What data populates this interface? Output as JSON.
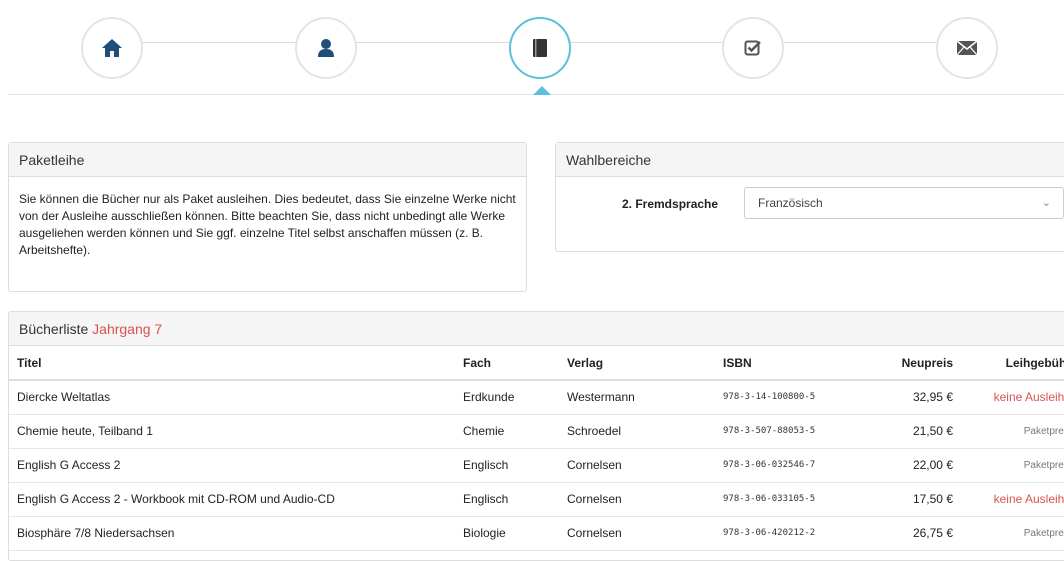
{
  "wizard": {
    "steps": [
      {
        "icon": "home-icon",
        "active": false
      },
      {
        "icon": "user-icon",
        "active": false
      },
      {
        "icon": "book-icon",
        "active": true
      },
      {
        "icon": "check-square-icon",
        "active": false
      },
      {
        "icon": "envelope-icon",
        "active": false
      }
    ],
    "colors": {
      "active": "#5bc0de",
      "icon": "#1f4e79",
      "check": "#555555"
    }
  },
  "paket": {
    "title": "Paketleihe",
    "text": "Sie können die Bücher nur als Paket ausleihen. Dies bedeutet, dass Sie einzelne Werke nicht von der Ausleihe ausschließen können. Bitte beachten Sie, dass nicht unbedingt alle Werke ausgeliehen werden können und Sie ggf. einzelne Titel selbst anschaffen müssen (z. B. Arbeitshefte)."
  },
  "wahl": {
    "title": "Wahlbereiche",
    "label": "2. Fremdsprache",
    "selected": "Französisch"
  },
  "buecher": {
    "title": "Bücherliste",
    "jahrgang": "Jahrgang 7",
    "columns": [
      "Titel",
      "Fach",
      "Verlag",
      "ISBN",
      "Neupreis",
      "Leihgebühr"
    ],
    "rows": [
      {
        "titel": "Diercke Weltatlas",
        "fach": "Erdkunde",
        "verlag": "Westermann",
        "isbn": "978-3-14-100800-5",
        "neupreis": "32,95 €",
        "leih": "keine Ausleihe"
      },
      {
        "titel": "Chemie heute, Teilband 1",
        "fach": "Chemie",
        "verlag": "Schroedel",
        "isbn": "978-3-507-88053-5",
        "neupreis": "21,50 €",
        "leih": "Paketpreis"
      },
      {
        "titel": "English G Access 2",
        "fach": "Englisch",
        "verlag": "Cornelsen",
        "isbn": "978-3-06-032546-7",
        "neupreis": "22,00 €",
        "leih": "Paketpreis"
      },
      {
        "titel": "English G Access 2 - Workbook mit CD-ROM und Audio-CD",
        "fach": "Englisch",
        "verlag": "Cornelsen",
        "isbn": "978-3-06-033105-5",
        "neupreis": "17,50 €",
        "leih": "keine Ausleihe"
      },
      {
        "titel": "Biosphäre 7/8 Niedersachsen",
        "fach": "Biologie",
        "verlag": "Cornelsen",
        "isbn": "978-3-06-420212-2",
        "neupreis": "26,75 €",
        "leih": "Paketpreis"
      }
    ]
  }
}
